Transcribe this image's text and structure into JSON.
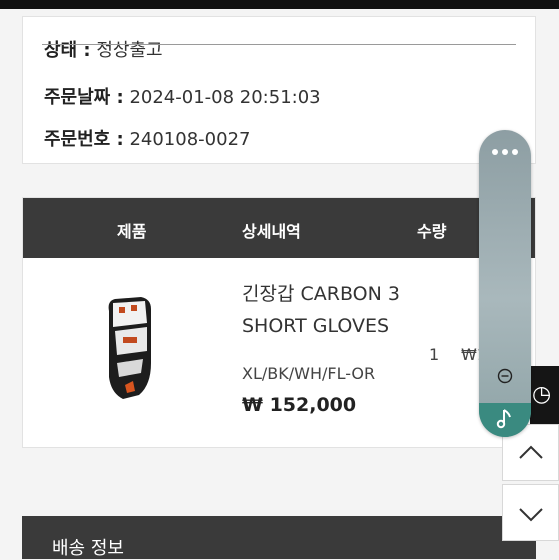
{
  "order_info": {
    "status_label": "상태 :",
    "status_value": "정상출고",
    "date_label": "주문날짜 :",
    "date_value": "2024-01-08 20:51:03",
    "number_label": "주문번호 :",
    "number_value": "240108-0027"
  },
  "table": {
    "headers": [
      "제품",
      "상세내역",
      "수량"
    ],
    "item": {
      "name_line1": "긴장갑 CARBON 3",
      "name_line2": "SHORT GLOVES",
      "option": "XL/BK/WH/FL-OR",
      "price": "₩ 152,000",
      "quantity": "1",
      "total_partial": "₩1"
    }
  },
  "shipping": {
    "title": "배송 정보"
  },
  "side_icons": {
    "more": "more-dots-icon",
    "minimize": "minus-circle-icon",
    "music": "music-note-icon",
    "up": "chevron-up-icon",
    "down": "chevron-down-icon"
  }
}
